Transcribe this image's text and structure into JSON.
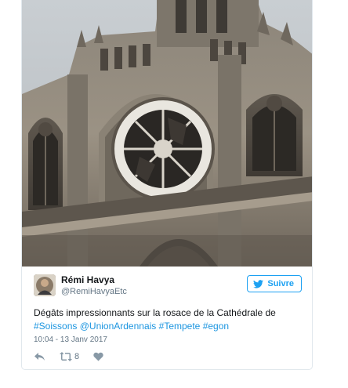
{
  "tweet": {
    "author": {
      "name": "Rémi Havya",
      "handle": "@RemiHavyaEtc"
    },
    "follow_button": {
      "label": "Suivre",
      "icon": "twitter-bird-icon"
    },
    "text": {
      "line1": "Dégâts impressionnants sur la rosace de la Cathédrale de",
      "hashtag_soissons": "#Soissons",
      "mention_union": "@UnionArdennais",
      "hashtag_tempete": "#Tempete",
      "hashtag_egon": "#egon"
    },
    "timestamp": "10:04 - 13 Janv 2017",
    "actions": {
      "reply_icon": "reply-icon",
      "retweet_icon": "retweet-icon",
      "retweet_count": "8",
      "like_icon": "heart-icon"
    },
    "photo": {
      "subject": "cathedral-facade-with-damaged-rose-window"
    },
    "colors": {
      "link": "#1b95e0",
      "follow": "#1da1f2",
      "secondary_text": "#657786",
      "primary_text": "#14171a",
      "border": "#e1e8ed"
    }
  }
}
